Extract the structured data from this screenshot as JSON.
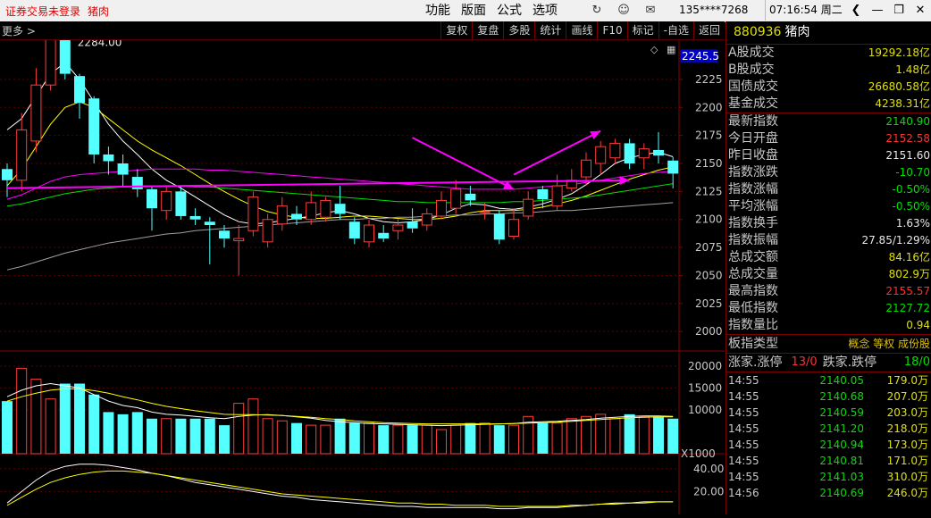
{
  "titlebar": {
    "login_status": "证券交易未登录",
    "index_name": "猪肉",
    "menu": [
      "功能",
      "版面",
      "公式",
      "选项"
    ],
    "phone": "135****7268",
    "time": "07:16:54 周二"
  },
  "toolbar": {
    "more_label": "更多",
    "buttons": [
      "复权",
      "复盘",
      "多股",
      "统计",
      "画线",
      "F10",
      "标记",
      "-自选",
      "返回"
    ]
  },
  "chart_data": {
    "type": "candlestick",
    "main": {
      "yaxis_ticks": [
        2225,
        2200,
        2175,
        2150,
        2125,
        2100,
        2075,
        2050,
        2025,
        2000
      ],
      "ylim": [
        1985,
        2260
      ],
      "high_label": "2284.00",
      "current_marker": "2245.5",
      "candles": [
        {
          "o": 2145,
          "c": 2135,
          "h": 2150,
          "l": 2120
        },
        {
          "o": 2135,
          "c": 2180,
          "h": 2195,
          "l": 2125
        },
        {
          "o": 2170,
          "c": 2220,
          "h": 2235,
          "l": 2160
        },
        {
          "o": 2220,
          "c": 2270,
          "h": 2285,
          "l": 2215
        },
        {
          "o": 2276,
          "c": 2230,
          "h": 2284,
          "l": 2225
        },
        {
          "o": 2228,
          "c": 2204,
          "h": 2230,
          "l": 2190
        },
        {
          "o": 2208,
          "c": 2158,
          "h": 2210,
          "l": 2150
        },
        {
          "o": 2158,
          "c": 2152,
          "h": 2165,
          "l": 2140
        },
        {
          "o": 2150,
          "c": 2140,
          "h": 2158,
          "l": 2130
        },
        {
          "o": 2138,
          "c": 2127,
          "h": 2145,
          "l": 2120
        },
        {
          "o": 2127,
          "c": 2110,
          "h": 2130,
          "l": 2090
        },
        {
          "o": 2108,
          "c": 2125,
          "h": 2130,
          "l": 2100
        },
        {
          "o": 2125,
          "c": 2103,
          "h": 2130,
          "l": 2100
        },
        {
          "o": 2103,
          "c": 2100,
          "h": 2110,
          "l": 2095
        },
        {
          "o": 2098,
          "c": 2095,
          "h": 2102,
          "l": 2060
        },
        {
          "o": 2090,
          "c": 2083,
          "h": 2095,
          "l": 2075
        },
        {
          "o": 2081,
          "c": 2083,
          "h": 2095,
          "l": 2050
        },
        {
          "o": 2090,
          "c": 2120,
          "h": 2125,
          "l": 2085
        },
        {
          "o": 2080,
          "c": 2100,
          "h": 2105,
          "l": 2075
        },
        {
          "o": 2096,
          "c": 2112,
          "h": 2120,
          "l": 2090
        },
        {
          "o": 2105,
          "c": 2100,
          "h": 2112,
          "l": 2095
        },
        {
          "o": 2100,
          "c": 2115,
          "h": 2125,
          "l": 2095
        },
        {
          "o": 2102,
          "c": 2117,
          "h": 2120,
          "l": 2098
        },
        {
          "o": 2114,
          "c": 2105,
          "h": 2130,
          "l": 2100
        },
        {
          "o": 2098,
          "c": 2083,
          "h": 2102,
          "l": 2078
        },
        {
          "o": 2080,
          "c": 2095,
          "h": 2100,
          "l": 2075
        },
        {
          "o": 2088,
          "c": 2083,
          "h": 2095,
          "l": 2080
        },
        {
          "o": 2090,
          "c": 2095,
          "h": 2100,
          "l": 2082
        },
        {
          "o": 2098,
          "c": 2092,
          "h": 2110,
          "l": 2088
        },
        {
          "o": 2095,
          "c": 2105,
          "h": 2110,
          "l": 2090
        },
        {
          "o": 2103,
          "c": 2117,
          "h": 2125,
          "l": 2100
        },
        {
          "o": 2110,
          "c": 2127,
          "h": 2135,
          "l": 2105
        },
        {
          "o": 2123,
          "c": 2117,
          "h": 2130,
          "l": 2112
        },
        {
          "o": 2107,
          "c": 2107,
          "h": 2115,
          "l": 2100
        },
        {
          "o": 2105,
          "c": 2082,
          "h": 2108,
          "l": 2078
        },
        {
          "o": 2085,
          "c": 2100,
          "h": 2110,
          "l": 2082
        },
        {
          "o": 2103,
          "c": 2118,
          "h": 2125,
          "l": 2100
        },
        {
          "o": 2127,
          "c": 2118,
          "h": 2130,
          "l": 2110
        },
        {
          "o": 2112,
          "c": 2130,
          "h": 2140,
          "l": 2108
        },
        {
          "o": 2128,
          "c": 2135,
          "h": 2145,
          "l": 2125
        },
        {
          "o": 2138,
          "c": 2153,
          "h": 2160,
          "l": 2130
        },
        {
          "o": 2150,
          "c": 2165,
          "h": 2170,
          "l": 2140
        },
        {
          "o": 2155,
          "c": 2168,
          "h": 2172,
          "l": 2150
        },
        {
          "o": 2168,
          "c": 2150,
          "h": 2172,
          "l": 2145
        },
        {
          "o": 2155,
          "c": 2163,
          "h": 2168,
          "l": 2145
        },
        {
          "o": 2162,
          "c": 2157,
          "h": 2178,
          "l": 2150
        },
        {
          "o": 2152.58,
          "c": 2140.9,
          "h": 2155.57,
          "l": 2127.72
        }
      ],
      "ma_lines": [
        {
          "color": "#ffffff",
          "values": [
            2180,
            2190,
            2210,
            2230,
            2240,
            2225,
            2205,
            2185,
            2170,
            2158,
            2145,
            2135,
            2128,
            2120,
            2112,
            2104,
            2098,
            2096,
            2097,
            2099,
            2101,
            2103,
            2106,
            2108,
            2105,
            2101,
            2098,
            2097,
            2098,
            2100,
            2104,
            2110,
            2114,
            2113,
            2110,
            2109,
            2111,
            2114,
            2118,
            2123,
            2131,
            2140,
            2150,
            2155,
            2158,
            2160,
            2156
          ]
        },
        {
          "color": "#ffff00",
          "values": [
            2130,
            2145,
            2165,
            2185,
            2200,
            2205,
            2200,
            2190,
            2180,
            2170,
            2162,
            2155,
            2148,
            2140,
            2132,
            2125,
            2118,
            2112,
            2107,
            2104,
            2102,
            2101,
            2101,
            2102,
            2103,
            2103,
            2102,
            2101,
            2100,
            2100,
            2101,
            2103,
            2106,
            2108,
            2108,
            2108,
            2109,
            2111,
            2114,
            2117,
            2121,
            2126,
            2131,
            2136,
            2140,
            2144,
            2147
          ]
        },
        {
          "color": "#ff00ff",
          "values": [
            2118,
            2122,
            2128,
            2134,
            2138,
            2140,
            2141,
            2142,
            2143,
            2144,
            2145,
            2145,
            2145,
            2145,
            2144,
            2144,
            2143,
            2142,
            2141,
            2140,
            2139,
            2138,
            2137,
            2136,
            2135,
            2134,
            2133,
            2132,
            2131,
            2130,
            2129,
            2128,
            2127,
            2127,
            2127,
            2127,
            2128,
            2129,
            2130,
            2131,
            2133,
            2135,
            2137,
            2139,
            2141,
            2142,
            2143
          ]
        },
        {
          "color": "#00e000",
          "values": [
            2112,
            2114,
            2117,
            2120,
            2123,
            2125,
            2127,
            2128,
            2129,
            2130,
            2130,
            2130,
            2130,
            2129,
            2129,
            2128,
            2127,
            2126,
            2125,
            2124,
            2123,
            2122,
            2121,
            2120,
            2119,
            2118,
            2117,
            2116,
            2116,
            2115,
            2115,
            2115,
            2115,
            2115,
            2115,
            2116,
            2116,
            2117,
            2118,
            2119,
            2120,
            2122,
            2124,
            2126,
            2128,
            2130,
            2132
          ]
        },
        {
          "color": "#a0a0a0",
          "values": [
            2055,
            2058,
            2062,
            2066,
            2070,
            2073,
            2076,
            2079,
            2081,
            2083,
            2085,
            2087,
            2088,
            2090,
            2091,
            2092,
            2093,
            2094,
            2095,
            2096,
            2097,
            2098,
            2099,
            2100,
            2100,
            2101,
            2101,
            2102,
            2102,
            2103,
            2103,
            2104,
            2104,
            2105,
            2105,
            2106,
            2106,
            2107,
            2108,
            2108,
            2109,
            2110,
            2111,
            2112,
            2113,
            2114,
            2115
          ]
        }
      ],
      "trend_arrows": [
        {
          "from": [
            28,
            2173
          ],
          "to": [
            35,
            2127
          ]
        },
        {
          "from": [
            35,
            2140
          ],
          "to": [
            41,
            2179
          ]
        },
        {
          "from": [
            0,
            2128
          ],
          "to": [
            43,
            2135
          ]
        }
      ]
    },
    "volume": {
      "yaxis_ticks": [
        20000,
        15000,
        10000
      ],
      "ylim": [
        0,
        21000
      ],
      "multiplier_label": "X1000",
      "values": [
        12000,
        19500,
        17000,
        12500,
        16000,
        16000,
        13500,
        9500,
        9000,
        9500,
        8000,
        8000,
        8000,
        8000,
        8000,
        6500,
        11500,
        12500,
        8000,
        7500,
        7000,
        6500,
        6500,
        8000,
        7000,
        7000,
        6500,
        6500,
        6500,
        6500,
        5500,
        6500,
        7000,
        7000,
        6500,
        6500,
        8500,
        7000,
        7000,
        8000,
        8500,
        9000,
        8000,
        9000,
        8500,
        8500,
        8000
      ],
      "ma_lines": [
        {
          "color": "#ffffff",
          "values": [
            13000,
            14500,
            15500,
            16000,
            15500,
            15000,
            13500,
            12000,
            11000,
            10500,
            9500,
            9000,
            8800,
            8500,
            8200,
            8000,
            8500,
            8800,
            8900,
            8700,
            8400,
            8100,
            7600,
            7300,
            7100,
            6900,
            6800,
            6700,
            6600,
            6500,
            6400,
            6500,
            6600,
            6700,
            6800,
            6900,
            7200,
            7300,
            7400,
            7600,
            7800,
            8100,
            8300,
            8500,
            8600,
            8600,
            8500
          ]
        },
        {
          "color": "#ffff00",
          "values": [
            12000,
            13000,
            13800,
            14500,
            14800,
            14800,
            14400,
            13800,
            13000,
            12300,
            11500,
            10800,
            10300,
            9800,
            9400,
            9000,
            8900,
            8900,
            8800,
            8700,
            8500,
            8300,
            8000,
            7800,
            7500,
            7300,
            7100,
            7000,
            6900,
            6800,
            6800,
            6800,
            6800,
            6800,
            6800,
            6900,
            7000,
            7100,
            7200,
            7400,
            7600,
            7800,
            8000,
            8200,
            8300,
            8400,
            8400
          ]
        }
      ]
    },
    "indicator": {
      "yaxis_ticks": [
        40.0,
        20.0
      ],
      "ylim": [
        0,
        50
      ],
      "lines": [
        {
          "color": "#ffffff",
          "values": [
            10,
            20,
            30,
            38,
            42,
            44,
            44,
            43,
            41,
            39,
            36,
            34,
            31,
            28,
            26,
            24,
            22,
            20,
            18,
            16,
            15,
            13,
            12,
            11,
            10,
            9,
            8,
            7,
            7,
            6,
            6,
            6,
            6,
            6,
            5,
            5,
            6,
            6,
            6,
            7,
            8,
            9,
            10,
            10,
            11,
            11,
            11
          ]
        },
        {
          "color": "#ffff00",
          "values": [
            8,
            15,
            22,
            28,
            32,
            35,
            37,
            38,
            38,
            37,
            36,
            34,
            32,
            30,
            28,
            26,
            24,
            22,
            20,
            18,
            17,
            16,
            15,
            14,
            13,
            12,
            11,
            10,
            10,
            9,
            9,
            8,
            8,
            8,
            7,
            7,
            7,
            7,
            7,
            8,
            8,
            9,
            9,
            10,
            10,
            11,
            11
          ]
        }
      ]
    }
  },
  "quote": {
    "code": "880936",
    "name": "猪肉",
    "turnover": [
      {
        "label": "A股成交",
        "value": "19292.18亿",
        "color": "#e0e000"
      },
      {
        "label": "B股成交",
        "value": "1.48亿",
        "color": "#e0e000"
      },
      {
        "label": "国债成交",
        "value": "26680.58亿",
        "color": "#e0e000"
      },
      {
        "label": "基金成交",
        "value": "4238.31亿",
        "color": "#e0e000"
      }
    ],
    "index_stats": [
      {
        "label": "最新指数",
        "value": "2140.90",
        "color": "#00e000"
      },
      {
        "label": "今日开盘",
        "value": "2152.58",
        "color": "#ff3030"
      },
      {
        "label": "昨日收盘",
        "value": "2151.60",
        "color": "#e8e8e8"
      },
      {
        "label": "指数涨跌",
        "value": "-10.70",
        "color": "#00e000"
      },
      {
        "label": "指数涨幅",
        "value": "-0.50%",
        "color": "#00e000"
      },
      {
        "label": "平均涨幅",
        "value": "-0.50%",
        "color": "#00e000"
      },
      {
        "label": "指数换手",
        "value": "1.63%",
        "color": "#e8e8e8"
      },
      {
        "label": "指数振幅",
        "value": "27.85/1.29%",
        "color": "#e8e8e8"
      },
      {
        "label": "总成交额",
        "value": "84.16亿",
        "color": "#e0e000"
      },
      {
        "label": "总成交量",
        "value": "802.9万",
        "color": "#e0e000"
      },
      {
        "label": "最高指数",
        "value": "2155.57",
        "color": "#ff3030"
      },
      {
        "label": "最低指数",
        "value": "2127.72",
        "color": "#00e000"
      },
      {
        "label": "指数量比",
        "value": "0.94",
        "color": "#e0e000"
      }
    ],
    "type_label": "板指类型",
    "type_tags": "概念 等权 成份股",
    "up_label": "涨家.涨停",
    "up_value": "13/0",
    "down_label": "跌家.跌停",
    "down_value": "18/0",
    "ticks": [
      {
        "time": "14:55",
        "price": "2140.05",
        "vol": "179.0万"
      },
      {
        "time": "14:55",
        "price": "2140.68",
        "vol": "207.0万"
      },
      {
        "time": "14:55",
        "price": "2140.59",
        "vol": "203.0万"
      },
      {
        "time": "14:55",
        "price": "2141.20",
        "vol": "218.0万"
      },
      {
        "time": "14:55",
        "price": "2140.94",
        "vol": "173.0万"
      },
      {
        "time": "14:55",
        "price": "2140.81",
        "vol": "171.0万"
      },
      {
        "time": "14:55",
        "price": "2141.03",
        "vol": "310.0万"
      },
      {
        "time": "14:56",
        "price": "2140.69",
        "vol": "246.0万"
      }
    ]
  }
}
